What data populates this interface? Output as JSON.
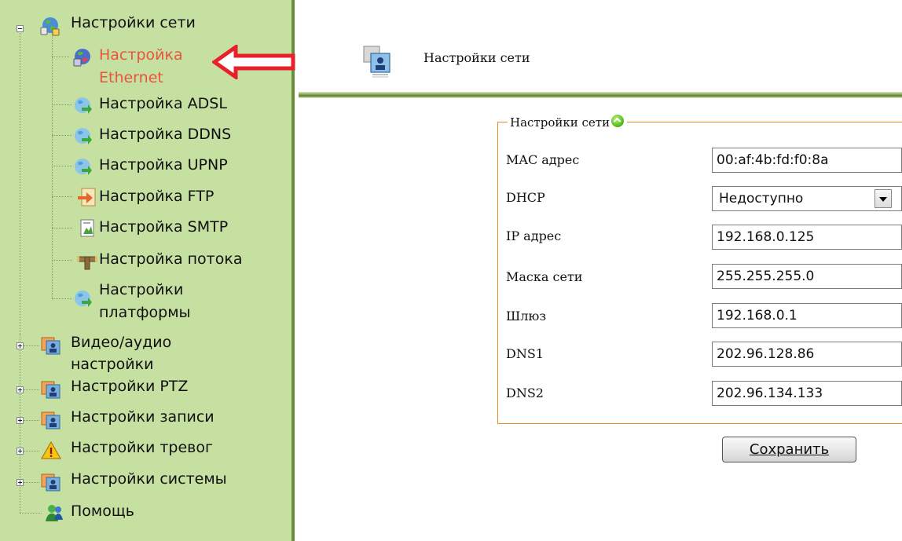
{
  "sidebar": {
    "network": {
      "label": "Настройки сети",
      "items": [
        {
          "label_line1": "Настройка",
          "label_line2": "Ethernet",
          "icon": "network-globe-icon",
          "active": true
        },
        {
          "label": "Настройка ADSL",
          "icon": "globe-icon"
        },
        {
          "label": "Настройка DDNS",
          "icon": "globe-icon"
        },
        {
          "label": "Настройка UPNP",
          "icon": "globe-icon"
        },
        {
          "label": "Настройка FTP",
          "icon": "ftp-arrow-icon"
        },
        {
          "label": "Настройка SMTP",
          "icon": "mail-document-icon"
        },
        {
          "label": "Настройка потока",
          "icon": "pipe-icon"
        },
        {
          "label_line1": "Настройки",
          "label_line2": "платформы",
          "icon": "globe-icon"
        }
      ]
    },
    "video_audio": {
      "label_line1": "Видео/аудио",
      "label_line2": "настройки"
    },
    "ptz": {
      "label": "Настройки PTZ"
    },
    "record": {
      "label": "Настройки записи"
    },
    "alarm": {
      "label": "Настройки тревог"
    },
    "system": {
      "label": "Настройки системы"
    },
    "help": {
      "label": "Помощь"
    }
  },
  "header": {
    "title": "Настройки сети"
  },
  "form": {
    "legend": "Настройки сети",
    "fields": {
      "mac": {
        "label": "MAC адрес",
        "value": "00:af:4b:fd:f0:8a"
      },
      "dhcp": {
        "label": "DHCP",
        "value": "Недоступно"
      },
      "ip": {
        "label": "IP адрес",
        "value": "192.168.0.125"
      },
      "mask": {
        "label": "Маска сети",
        "value": "255.255.255.0"
      },
      "gateway": {
        "label": "Шлюз",
        "value": "192.168.0.1"
      },
      "dns1": {
        "label": "DNS1",
        "value": "202.96.128.86"
      },
      "dns2": {
        "label": "DNS2",
        "value": "202.96.134.133"
      }
    },
    "save_label": "Сохранить"
  },
  "colors": {
    "sidebar_bg": "#c6e0a2",
    "active_item": "#e8553c",
    "fieldset_border": "#e98a2c",
    "annotation_arrow": "#e8202a"
  }
}
